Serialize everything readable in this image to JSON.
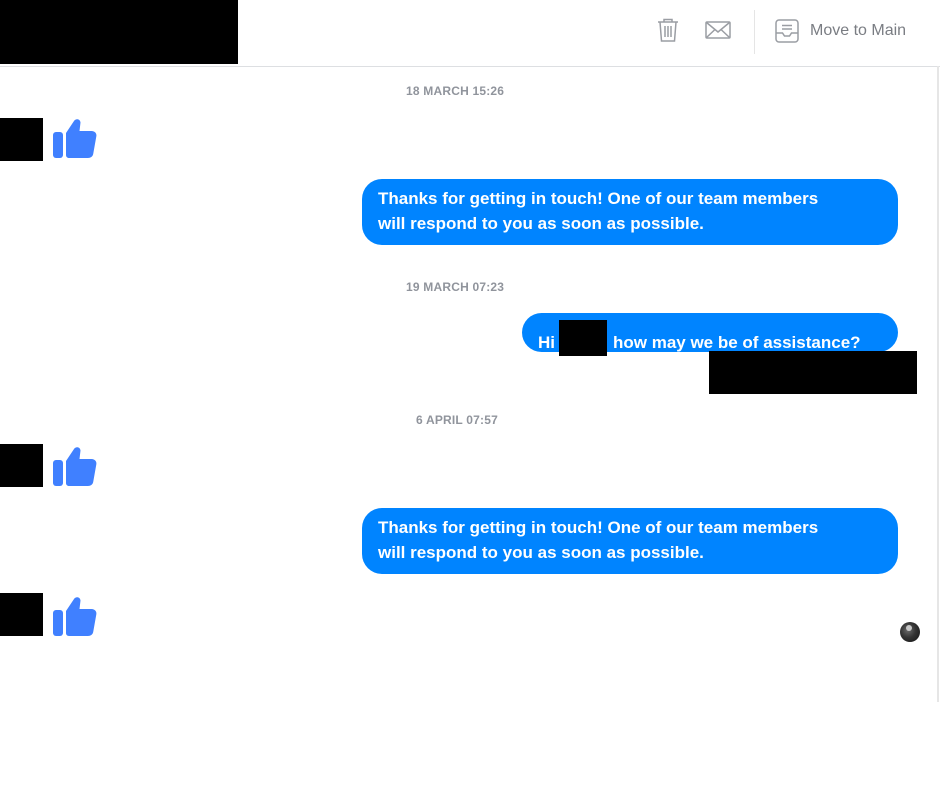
{
  "header": {
    "move_to_main_label": "Move to Main",
    "icons": [
      "trash-icon",
      "mail-icon",
      "inbox-tray-icon"
    ]
  },
  "conversation": {
    "stamp_1": "18 MARCH 15:26",
    "stamp_2": "19 MARCH 07:23",
    "stamp_3": "6 APRIL 07:57",
    "auto_reply_line1": "Thanks for getting in touch! One of our team members",
    "auto_reply_line2": "will respond to you as soon as possible.",
    "greeting_prefix": "Hi",
    "greeting_suffix": "how may we be of assistance?"
  },
  "colors": {
    "bubble": "#0084ff",
    "like": "#4080ff",
    "timestamp": "#90949c",
    "header_label": "#7a7d83"
  }
}
